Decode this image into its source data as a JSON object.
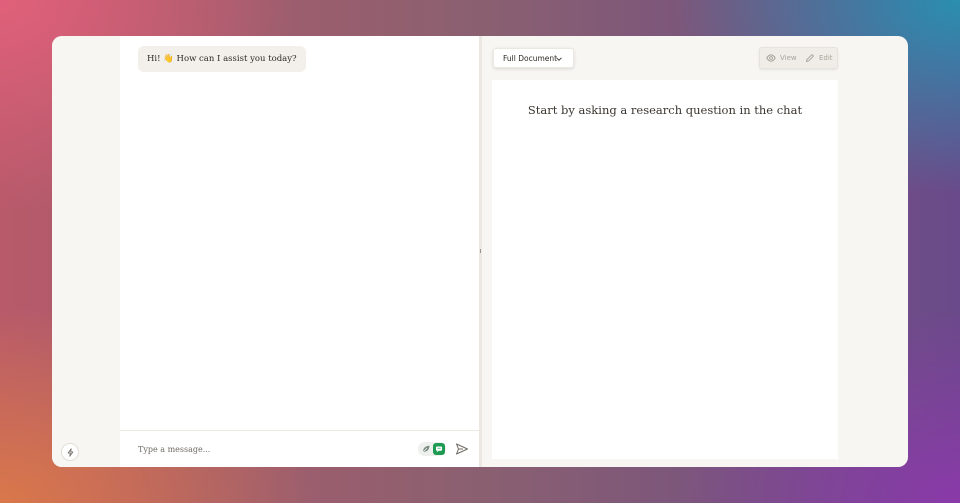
{
  "chat": {
    "greeting": "Hi! 👋 How can I assist you today?",
    "input_placeholder": "Type a message..."
  },
  "document": {
    "view_selector": "Full Document",
    "modes": {
      "view_label": "View",
      "edit_label": "Edit"
    },
    "empty_hint": "Start by asking a research question in the chat"
  },
  "icons": {
    "quick_action": "bolt-icon",
    "toggle_leaf": "leaf-icon",
    "toggle_chat": "chat-icon",
    "send": "send-icon",
    "dropdown": "chevron-down-icon",
    "view": "eye-icon",
    "edit": "pencil-icon"
  },
  "colors": {
    "window_bg": "#f8f6f2",
    "panel_bg": "#ffffff",
    "bubble_bg": "#f3f0eb",
    "toggle_active": "#1f9a52",
    "text": "#2d2a26",
    "muted": "#a8a39b"
  }
}
